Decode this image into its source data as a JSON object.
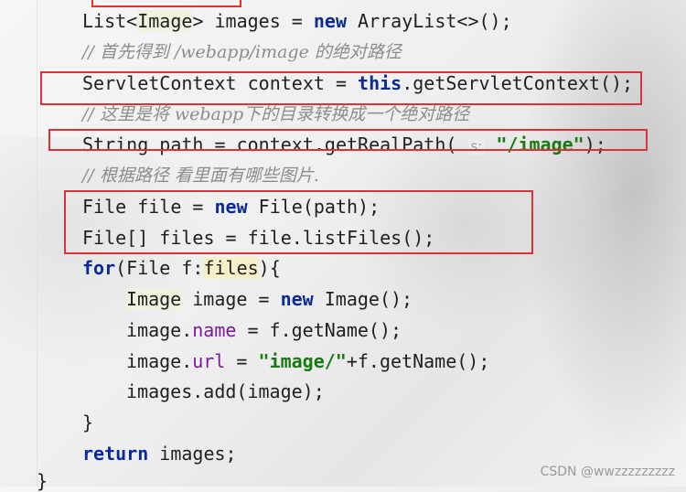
{
  "code": {
    "lines": [
      {
        "id": "l1",
        "text": "List<Image> images = new ArrayList<>();"
      },
      {
        "id": "l2",
        "text": "// 首先得到 /webapp/image 的绝对路径"
      },
      {
        "id": "l3",
        "text": "ServletContext context = this.getServletContext();"
      },
      {
        "id": "l4",
        "text": "// 这里是将 webapp下的目录转换成一个绝对路径"
      },
      {
        "id": "l5",
        "text": "String path = context.getRealPath( s: \"/image\");"
      },
      {
        "id": "l6",
        "text": "// 根据路径 看里面有哪些图片."
      },
      {
        "id": "l7",
        "text": "File file = new File(path);"
      },
      {
        "id": "l8",
        "text": "File[] files = file.listFiles();"
      },
      {
        "id": "l9",
        "text": "for(File f:files){"
      },
      {
        "id": "l10",
        "text": "Image image = new Image();"
      },
      {
        "id": "l11",
        "text": "image.name = f.getName();"
      },
      {
        "id": "l12",
        "text": "image.url = \"image/\"+f.getName();"
      },
      {
        "id": "l13",
        "text": "images.add(image);"
      },
      {
        "id": "l14",
        "text": "}"
      },
      {
        "id": "l15",
        "text": "return images;"
      },
      {
        "id": "l16",
        "text": "}"
      }
    ],
    "tokens": {
      "list": "List<",
      "image_t": "Image",
      "list_rest": "> images = ",
      "new": "new",
      "arraylist": " ArrayList<>();",
      "c1": "// 首先得到 /webapp/image 的绝对路径",
      "servlet_pre": "ServletContext context = ",
      "this": "this",
      "servlet_post": ".getServletContext();",
      "c2": "// 这里是将 webapp下的目录转换成一个绝对路径",
      "path_pre": "String path = context.getRealPath( ",
      "hint_s": "s:",
      "path_str": "\"/image\"",
      "path_post": ");",
      "c3": "// 根据路径 看里面有哪些图片.",
      "file_pre": "File file = ",
      "file_post": " File(path);",
      "files_line": "File[] files = file.listFiles();",
      "for": "for",
      "for_mid": "(File f:",
      "files_var": "files",
      "for_post": "){",
      "img_t": "Image",
      "img_mid": " image = ",
      "img_post": " Image();",
      "name_pre": "image.",
      "name_fld": "name",
      "name_post": " = f.getName();",
      "url_pre": "image.",
      "url_fld": "url",
      "url_eq": " = ",
      "url_str": "\"image/\"",
      "url_post": "+f.getName();",
      "add_line": "images.add(image);",
      "close_brace": "}",
      "return": "return",
      "return_post": " images;",
      "end_brace": "}"
    }
  },
  "colors": {
    "keyword": "#0a2a9a",
    "string": "#1a7a12",
    "field": "#7a1a9a",
    "comment": "#8c8c8c",
    "highlight_box": "#d8333a"
  },
  "watermark": "CSDN @wwzzzzzzzzz"
}
